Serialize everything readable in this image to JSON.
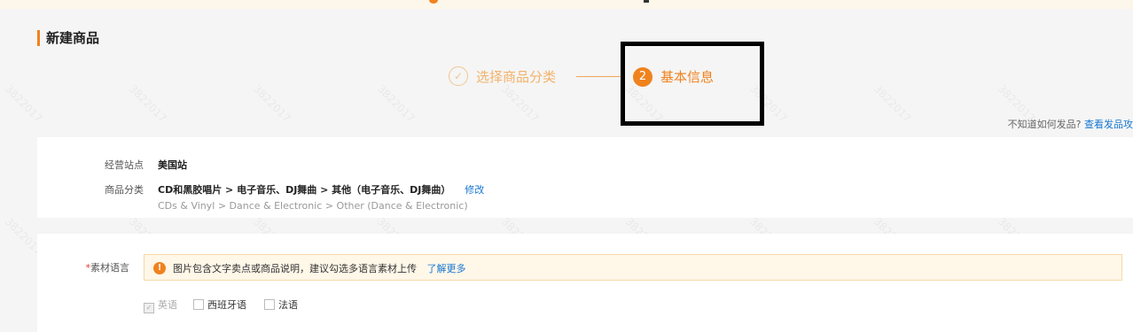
{
  "header": {
    "title": "新建商品",
    "steps": [
      {
        "label": "选择商品分类",
        "icon": "✓",
        "state": "done"
      },
      {
        "label": "基本信息",
        "number": "2",
        "state": "active"
      }
    ],
    "help_text": "不知道如何发品?",
    "help_link": "查看发品攻"
  },
  "category_card": {
    "site_label": "经营站点",
    "site_value": "美国站",
    "category_label": "商品分类",
    "category_path": "CD和黑胶唱片 > 电子音乐、DJ舞曲 > 其他（电子音乐、DJ舞曲）",
    "edit_link": "修改",
    "category_path_en": "CDs & Vinyl > Dance & Electronic > Other (Dance & Electronic)"
  },
  "language_card": {
    "required_mark": "*",
    "label": "素材语言",
    "notice_icon": "!",
    "notice_text": "图片包含文字卖点或商品说明，建议勾选多语言素材上传",
    "notice_link": "了解更多",
    "options": [
      {
        "label": "英语",
        "checked": true,
        "disabled": true
      },
      {
        "label": "西班牙语",
        "checked": false,
        "disabled": false
      },
      {
        "label": "法语",
        "checked": false,
        "disabled": false
      }
    ]
  },
  "watermark": "3822017",
  "colors": {
    "accent": "#f0821e",
    "link": "#1677d2",
    "highlight_border": "#000000"
  }
}
